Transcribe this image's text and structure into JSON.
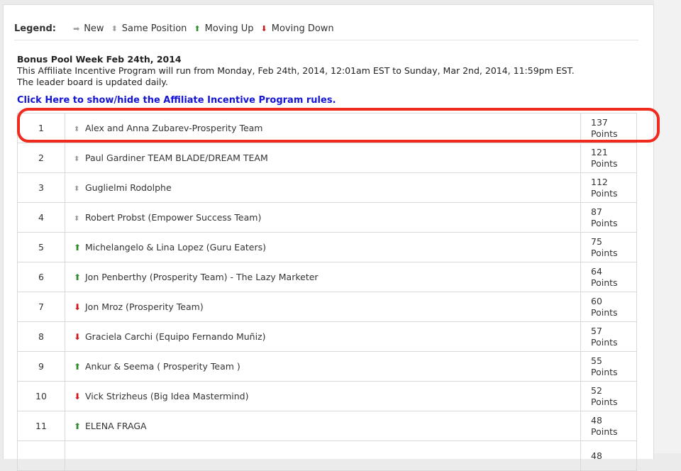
{
  "legend": {
    "title": "Legend:",
    "items": [
      {
        "glyph": "➡",
        "label": "New",
        "type": "new"
      },
      {
        "glyph": "⬍",
        "label": "Same Position",
        "type": "same"
      },
      {
        "glyph": "⬆",
        "label": "Moving Up",
        "type": "up"
      },
      {
        "glyph": "⬇",
        "label": "Moving Down",
        "type": "down"
      }
    ]
  },
  "program": {
    "title": "Bonus Pool Week Feb 24th, 2014",
    "line1": "This Affiliate Incentive Program will run from Monday, Feb 24th, 2014, 12:01am EST to Sunday, Mar 2nd, 2014, 11:59pm EST.",
    "line2": "The leader board is updated daily.",
    "rules_link": "Click Here to show/hide the Affiliate Incentive Program rules."
  },
  "glyphs": {
    "same": "⬍",
    "up": "⬆",
    "down": "⬇"
  },
  "colors": {
    "up": "#2e8b2e",
    "down": "#d01818",
    "link": "#1515d6",
    "highlight": "#f02a1d"
  },
  "leaderboard": [
    {
      "rank": "1",
      "trend": "same",
      "name": "Alex and Anna Zubarev-Prosperity Team",
      "points": "137",
      "unit": "Points"
    },
    {
      "rank": "2",
      "trend": "same",
      "name": "Paul Gardiner TEAM BLADE/DREAM TEAM",
      "points": "121",
      "unit": "Points"
    },
    {
      "rank": "3",
      "trend": "same",
      "name": "Guglielmi Rodolphe",
      "points": "112",
      "unit": "Points"
    },
    {
      "rank": "4",
      "trend": "same",
      "name": "Robert Probst (Empower Success Team)",
      "points": "87",
      "unit": "Points"
    },
    {
      "rank": "5",
      "trend": "up",
      "name": "Michelangelo & Lina Lopez (Guru Eaters)",
      "points": "75",
      "unit": "Points"
    },
    {
      "rank": "6",
      "trend": "up",
      "name": "Jon Penberthy (Prosperity Team) - The Lazy Marketer",
      "points": "64",
      "unit": "Points"
    },
    {
      "rank": "7",
      "trend": "down",
      "name": "Jon Mroz (Prosperity Team)",
      "points": "60",
      "unit": "Points"
    },
    {
      "rank": "8",
      "trend": "down",
      "name": "Graciela Carchi (Equipo Fernando Muñiz)",
      "points": "57",
      "unit": "Points"
    },
    {
      "rank": "9",
      "trend": "up",
      "name": "Ankur & Seema ( Prosperity Team )",
      "points": "55",
      "unit": "Points"
    },
    {
      "rank": "10",
      "trend": "down",
      "name": "Vick Strizheus (Big Idea Mastermind)",
      "points": "52",
      "unit": "Points"
    },
    {
      "rank": "11",
      "trend": "up",
      "name": "ELENA FRAGA",
      "points": "48",
      "unit": "Points"
    },
    {
      "rank": "",
      "trend": "",
      "name": "",
      "points": "48",
      "unit": ""
    }
  ]
}
